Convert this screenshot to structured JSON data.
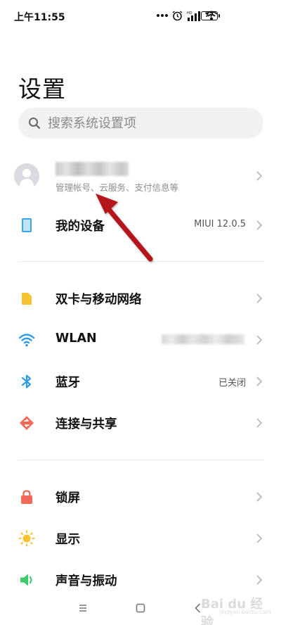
{
  "status_bar": {
    "time": "上午11:55",
    "battery": "77",
    "icons": [
      "more-dots-icon",
      "alarm-icon",
      "hd-signal-icon",
      "wifi-icon",
      "battery-icon"
    ]
  },
  "page": {
    "title": "设置"
  },
  "search": {
    "placeholder": "搜索系统设置项"
  },
  "account": {
    "subtitle": "管理帐号、云服务、支付信息等"
  },
  "sections": {
    "device": {
      "label": "我的设备",
      "value": "MIUI 12.0.5",
      "icon": "device-icon"
    },
    "network": [
      {
        "label": "双卡与移动网络",
        "value": "",
        "icon": "sim-icon"
      },
      {
        "label": "WLAN",
        "value": "",
        "icon": "wifi-icon"
      },
      {
        "label": "蓝牙",
        "value": "已关闭",
        "icon": "bluetooth-icon"
      },
      {
        "label": "连接与共享",
        "value": "",
        "icon": "share-icon"
      }
    ],
    "display": [
      {
        "label": "锁屏",
        "value": "",
        "icon": "lock-icon"
      },
      {
        "label": "显示",
        "value": "",
        "icon": "sun-icon"
      },
      {
        "label": "声音与振动",
        "value": "",
        "icon": "speaker-icon"
      }
    ]
  },
  "watermark": {
    "text": "Bai du 经验",
    "sub": "jingyan.baidu.com"
  },
  "colors": {
    "device": "#3aa7e6",
    "sim": "#f6c431",
    "wifi": "#2f9be8",
    "bluetooth": "#2f9be8",
    "share": "#f06a57",
    "lock": "#f06a57",
    "sun": "#f6c431",
    "speaker": "#3ecb6e",
    "annotation_arrow": "#b4161b"
  }
}
